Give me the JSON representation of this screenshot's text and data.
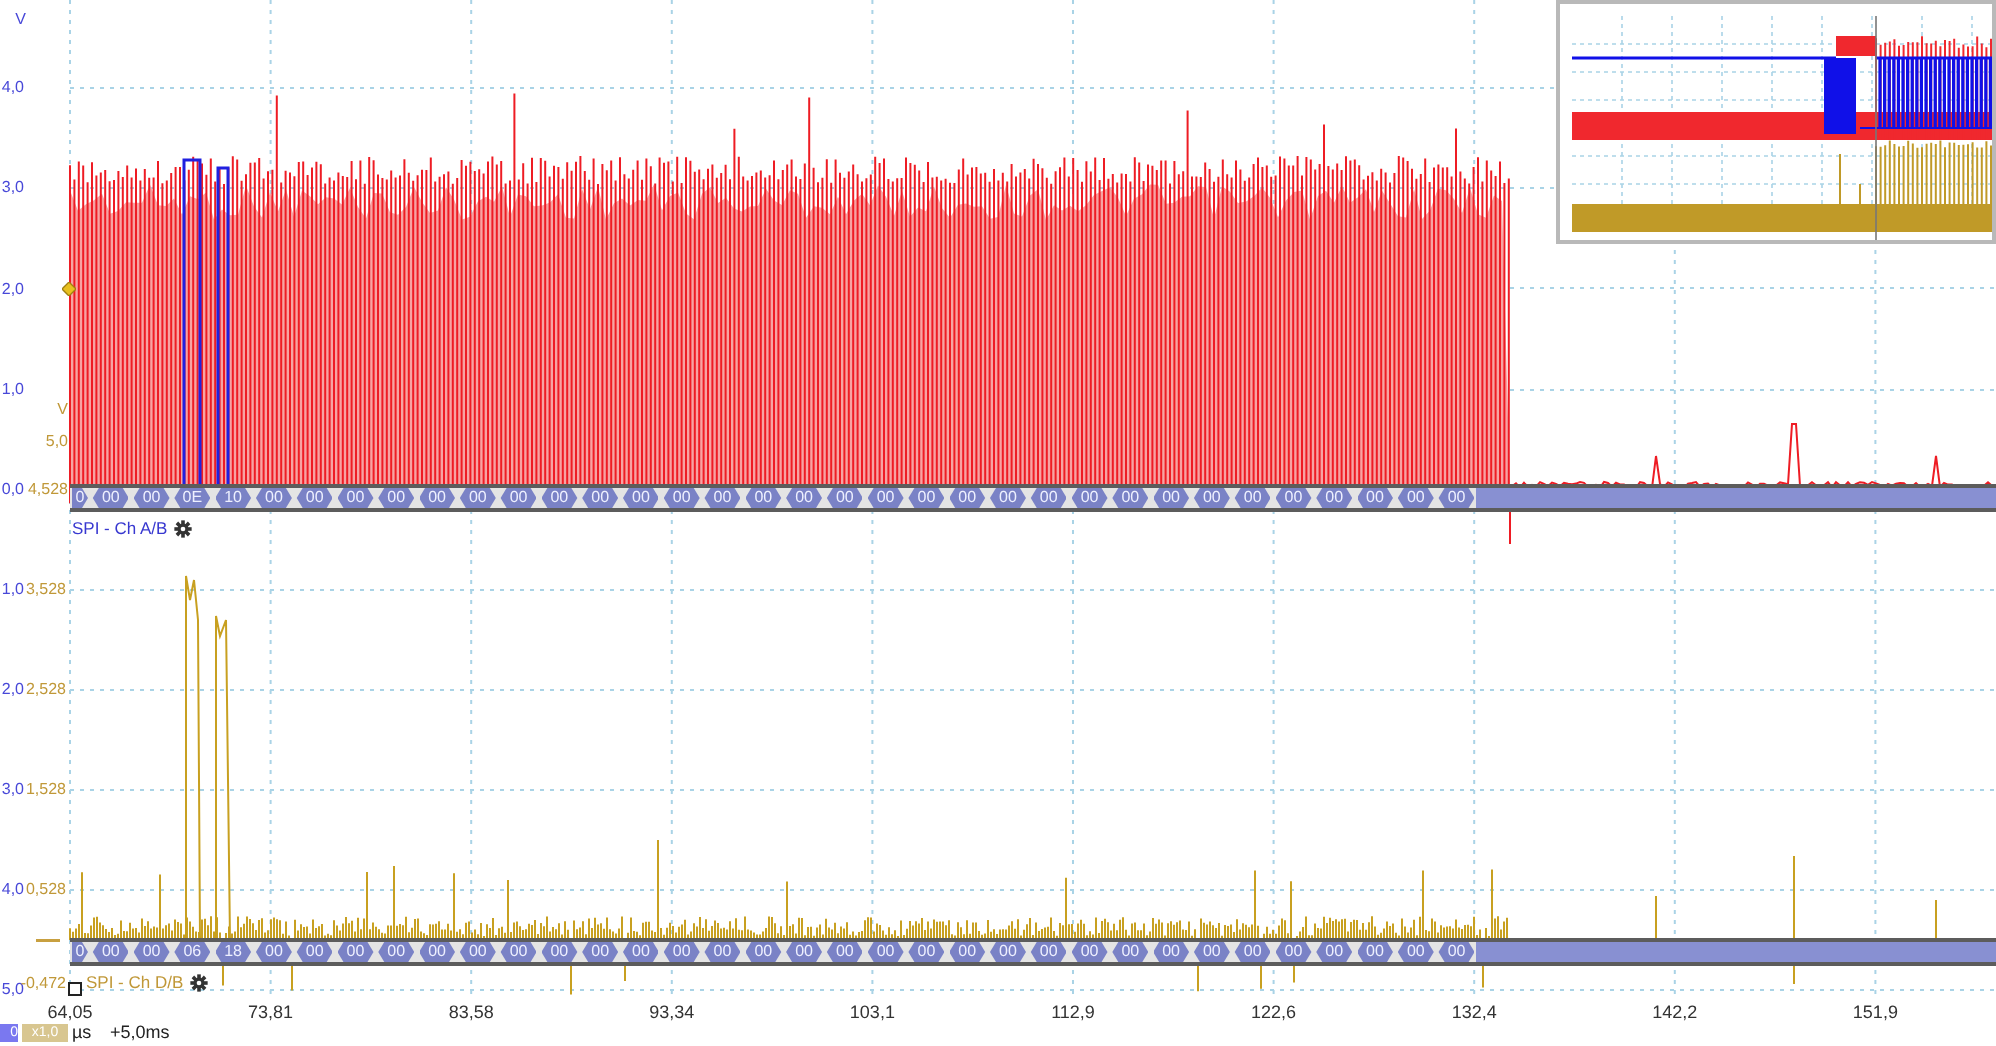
{
  "top_panel": {
    "blue_axis": {
      "unit": "V",
      "ticks": [
        "4,0",
        "3,0",
        "2,0",
        "1,0",
        "0,0"
      ]
    },
    "gold_axis": {
      "unit": "V",
      "ticks": [
        "5,0",
        "4,528"
      ]
    },
    "decoder": {
      "label": "SPI - Ch A/B",
      "bytes": [
        "0",
        "00",
        "00",
        "0E",
        "10",
        "00",
        "00",
        "00",
        "00",
        "00",
        "00",
        "00",
        "00",
        "00",
        "00",
        "00",
        "00",
        "00",
        "00",
        "00",
        "00",
        "00",
        "00",
        "00",
        "00",
        "00",
        "00",
        "00",
        "00",
        "00",
        "00",
        "00",
        "00",
        "00",
        "00"
      ]
    }
  },
  "bottom_panel": {
    "blue_axis": {
      "ticks": [
        "1,0",
        "2,0",
        "3,0",
        "4,0",
        "5,0"
      ]
    },
    "gold_axis": {
      "ticks": [
        "3,528",
        "2,528",
        "1,528",
        "0,528",
        "-0,472"
      ]
    },
    "decoder": {
      "label": "SPI - Ch D/B",
      "bytes": [
        "0",
        "00",
        "00",
        "06",
        "18",
        "00",
        "00",
        "00",
        "00",
        "00",
        "00",
        "00",
        "00",
        "00",
        "00",
        "00",
        "00",
        "00",
        "00",
        "00",
        "00",
        "00",
        "00",
        "00",
        "00",
        "00",
        "00",
        "00",
        "00",
        "00",
        "00",
        "00",
        "00",
        "00",
        "00"
      ]
    }
  },
  "x_axis": {
    "ticks": [
      "64,05",
      "73,81",
      "83,58",
      "93,34",
      "103,1",
      "112,9",
      "122,6",
      "132,4",
      "142,2",
      "151,9"
    ]
  },
  "status_bar": {
    "channel_a_scale": "0",
    "channel_d_scale": "x1,0",
    "unit": "µs",
    "offset": "+5,0ms"
  }
}
